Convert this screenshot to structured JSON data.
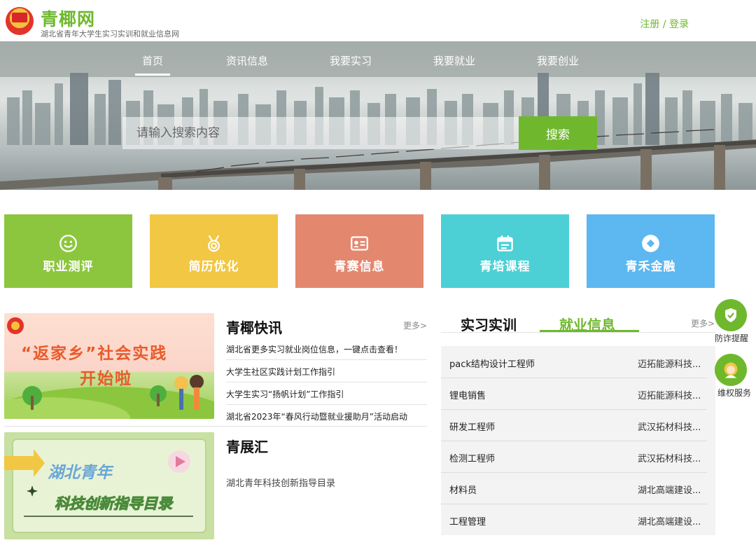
{
  "header": {
    "site_name": "青椰网",
    "subtitle": "湖北省青年大学生实习实训和就业信息网",
    "register": "注册",
    "separator": " / ",
    "login": "登录"
  },
  "nav": {
    "items": [
      {
        "label": "首页",
        "active": true
      },
      {
        "label": "资讯信息"
      },
      {
        "label": "我要实习"
      },
      {
        "label": "我要就业"
      },
      {
        "label": "我要创业"
      }
    ]
  },
  "search": {
    "placeholder": "请输入搜索内容",
    "button": "搜索"
  },
  "tiles": [
    {
      "label": "职业测评",
      "color": "#8cc63f",
      "icon": "smile-icon"
    },
    {
      "label": "简历优化",
      "color": "#f2c744",
      "icon": "medal-icon"
    },
    {
      "label": "青赛信息",
      "color": "#e4876f",
      "icon": "id-card-icon"
    },
    {
      "label": "青培课程",
      "color": "#4dd0d5",
      "icon": "calendar-icon"
    },
    {
      "label": "青禾金融",
      "color": "#5db7f0",
      "icon": "diamond-icon"
    }
  ],
  "news": {
    "title": "青椰快讯",
    "more": "更多>",
    "banner_text_1": "“返家乡”社会实践",
    "banner_text_2": "开始啦",
    "items": [
      "湖北省更多实习就业岗位信息，一键点击查看！",
      "大学生社区实践计划工作指引",
      "大学生实习“扬帆计划”工作指引",
      "湖北省2023年“春风行动暨就业援助月”活动启动"
    ]
  },
  "exhibit": {
    "title": "青展汇",
    "banner_text_1": "湖北青年",
    "banner_text_2": "科技创新指导目录",
    "items": [
      "湖北青年科技创新指导目录"
    ]
  },
  "jobs": {
    "tabs": [
      {
        "label": "实习实训",
        "active": false
      },
      {
        "label": "就业信息",
        "active": true
      }
    ],
    "more": "更多>",
    "rows": [
      {
        "title": "pack结构设计工程师",
        "company": "迈拓能源科技..."
      },
      {
        "title": "锂电销售",
        "company": "迈拓能源科技..."
      },
      {
        "title": "研发工程师",
        "company": "武汉拓材科技..."
      },
      {
        "title": "检测工程师",
        "company": "武汉拓材科技..."
      },
      {
        "title": "材料员",
        "company": "湖北高端建设..."
      },
      {
        "title": "工程管理",
        "company": "湖北高端建设..."
      }
    ]
  },
  "float": {
    "fraud_alert": "防诈提醒",
    "rights": "维权服务"
  },
  "colors": {
    "brand_green": "#6fb82e"
  }
}
